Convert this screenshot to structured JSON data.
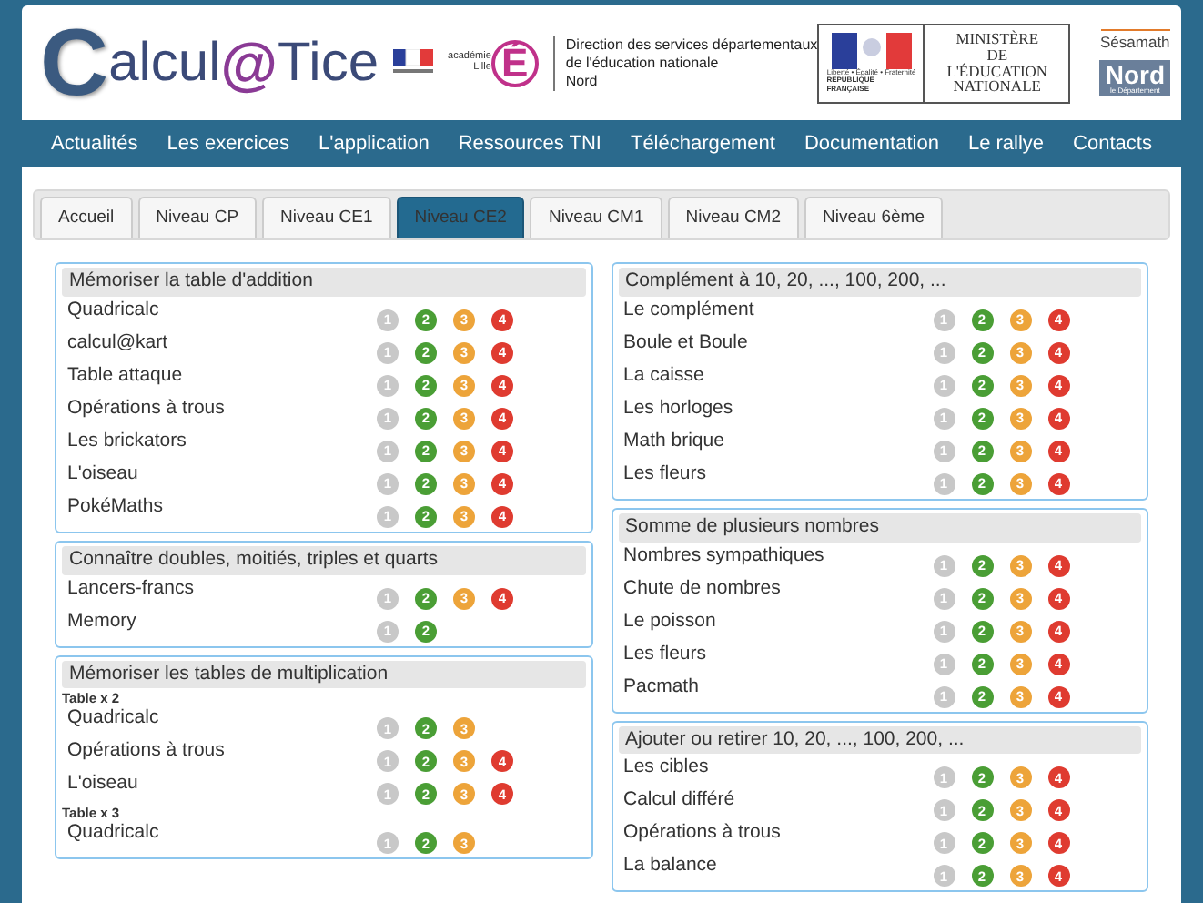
{
  "header": {
    "logo": {
      "initial": "C",
      "part1": "alcul",
      "at": "@",
      "part2": "Tice"
    },
    "academie": {
      "line1": "académie",
      "line2": "Lille",
      "letter": "É"
    },
    "direction": [
      "Direction des services départementaux",
      "de l'éducation nationale",
      "Nord"
    ],
    "ministry": {
      "motto": "Liberté • Égalité • Fraternité",
      "republic": "RÉPUBLIQUE FRANÇAISE",
      "name": [
        "MINISTÈRE",
        "DE L'ÉDUCATION",
        "NATIONALE"
      ]
    },
    "sesamath": "Sésamath",
    "nord": {
      "name": "Nord",
      "sub": "le Département"
    }
  },
  "nav": [
    "Actualités",
    "Les exercices",
    "L'application",
    "Ressources TNI",
    "Téléchargement",
    "Documentation",
    "Le rallye",
    "Contacts"
  ],
  "tabs": [
    {
      "label": "Accueil",
      "selected": false
    },
    {
      "label": "Niveau CP",
      "selected": false
    },
    {
      "label": "Niveau CE1",
      "selected": false
    },
    {
      "label": "Niveau CE2",
      "selected": true
    },
    {
      "label": "Niveau CM1",
      "selected": false
    },
    {
      "label": "Niveau CM2",
      "selected": false
    },
    {
      "label": "Niveau 6ème",
      "selected": false
    }
  ],
  "columns": [
    [
      {
        "title": "Mémoriser la table d'addition",
        "items": [
          {
            "kind": "exercise",
            "name": "Quadricalc",
            "levels": [
              {
                "label": "1",
                "color": "#c8c8c8"
              },
              {
                "label": "2",
                "color": "#4a9e35"
              },
              {
                "label": "3",
                "color": "#eda43a"
              },
              {
                "label": "4",
                "color": "#df3b30"
              }
            ]
          },
          {
            "kind": "exercise",
            "name": "calcul@kart",
            "levels": [
              {
                "label": "1",
                "color": "#c8c8c8"
              },
              {
                "label": "2",
                "color": "#4a9e35"
              },
              {
                "label": "3",
                "color": "#eda43a"
              },
              {
                "label": "4",
                "color": "#df3b30"
              }
            ]
          },
          {
            "kind": "exercise",
            "name": "Table attaque",
            "levels": [
              {
                "label": "1",
                "color": "#c8c8c8"
              },
              {
                "label": "2",
                "color": "#4a9e35"
              },
              {
                "label": "3",
                "color": "#eda43a"
              },
              {
                "label": "4",
                "color": "#df3b30"
              }
            ]
          },
          {
            "kind": "exercise",
            "name": "Opérations à trous",
            "levels": [
              {
                "label": "1",
                "color": "#c8c8c8"
              },
              {
                "label": "2",
                "color": "#4a9e35"
              },
              {
                "label": "3",
                "color": "#eda43a"
              },
              {
                "label": "4",
                "color": "#df3b30"
              }
            ]
          },
          {
            "kind": "exercise",
            "name": "Les brickators",
            "levels": [
              {
                "label": "1",
                "color": "#c8c8c8"
              },
              {
                "label": "2",
                "color": "#4a9e35"
              },
              {
                "label": "3",
                "color": "#eda43a"
              },
              {
                "label": "4",
                "color": "#df3b30"
              }
            ]
          },
          {
            "kind": "exercise",
            "name": "L'oiseau",
            "levels": [
              {
                "label": "1",
                "color": "#c8c8c8"
              },
              {
                "label": "2",
                "color": "#4a9e35"
              },
              {
                "label": "3",
                "color": "#eda43a"
              },
              {
                "label": "4",
                "color": "#df3b30"
              }
            ]
          },
          {
            "kind": "exercise",
            "name": "PokéMaths",
            "levels": [
              {
                "label": "1",
                "color": "#c8c8c8"
              },
              {
                "label": "2",
                "color": "#4a9e35"
              },
              {
                "label": "3",
                "color": "#eda43a"
              },
              {
                "label": "4",
                "color": "#df3b30"
              }
            ]
          }
        ]
      },
      {
        "title": "Connaître doubles, moitiés, triples et quarts",
        "items": [
          {
            "kind": "exercise",
            "name": "Lancers-francs",
            "levels": [
              {
                "label": "1",
                "color": "#c8c8c8"
              },
              {
                "label": "2",
                "color": "#4a9e35"
              },
              {
                "label": "3",
                "color": "#eda43a"
              },
              {
                "label": "4",
                "color": "#df3b30"
              }
            ]
          },
          {
            "kind": "exercise",
            "name": "Memory",
            "levels": [
              {
                "label": "1",
                "color": "#c8c8c8"
              },
              {
                "label": "2",
                "color": "#4a9e35"
              }
            ]
          }
        ]
      },
      {
        "title": "Mémoriser les tables de multiplication",
        "items": [
          {
            "kind": "heading",
            "name": "Table x 2"
          },
          {
            "kind": "exercise",
            "name": "Quadricalc",
            "levels": [
              {
                "label": "1",
                "color": "#c8c8c8"
              },
              {
                "label": "2",
                "color": "#4a9e35"
              },
              {
                "label": "3",
                "color": "#eda43a"
              }
            ]
          },
          {
            "kind": "exercise",
            "name": "Opérations à trous",
            "levels": [
              {
                "label": "1",
                "color": "#c8c8c8"
              },
              {
                "label": "2",
                "color": "#4a9e35"
              },
              {
                "label": "3",
                "color": "#eda43a"
              },
              {
                "label": "4",
                "color": "#df3b30"
              }
            ]
          },
          {
            "kind": "exercise",
            "name": "L'oiseau",
            "levels": [
              {
                "label": "1",
                "color": "#c8c8c8"
              },
              {
                "label": "2",
                "color": "#4a9e35"
              },
              {
                "label": "3",
                "color": "#eda43a"
              },
              {
                "label": "4",
                "color": "#df3b30"
              }
            ]
          },
          {
            "kind": "heading",
            "name": "Table x 3"
          },
          {
            "kind": "exercise",
            "name": "Quadricalc",
            "levels": [
              {
                "label": "1",
                "color": "#c8c8c8"
              },
              {
                "label": "2",
                "color": "#4a9e35"
              },
              {
                "label": "3",
                "color": "#eda43a"
              }
            ]
          }
        ]
      }
    ],
    [
      {
        "title": "Complément à 10, 20, ..., 100, 200, ...",
        "items": [
          {
            "kind": "exercise",
            "name": "Le complément",
            "levels": [
              {
                "label": "1",
                "color": "#c8c8c8"
              },
              {
                "label": "2",
                "color": "#4a9e35"
              },
              {
                "label": "3",
                "color": "#eda43a"
              },
              {
                "label": "4",
                "color": "#df3b30"
              }
            ]
          },
          {
            "kind": "exercise",
            "name": "Boule et Boule",
            "levels": [
              {
                "label": "1",
                "color": "#c8c8c8"
              },
              {
                "label": "2",
                "color": "#4a9e35"
              },
              {
                "label": "3",
                "color": "#eda43a"
              },
              {
                "label": "4",
                "color": "#df3b30"
              }
            ]
          },
          {
            "kind": "exercise",
            "name": "La caisse",
            "levels": [
              {
                "label": "1",
                "color": "#c8c8c8"
              },
              {
                "label": "2",
                "color": "#4a9e35"
              },
              {
                "label": "3",
                "color": "#eda43a"
              },
              {
                "label": "4",
                "color": "#df3b30"
              }
            ]
          },
          {
            "kind": "exercise",
            "name": "Les horloges",
            "levels": [
              {
                "label": "1",
                "color": "#c8c8c8"
              },
              {
                "label": "2",
                "color": "#4a9e35"
              },
              {
                "label": "3",
                "color": "#eda43a"
              },
              {
                "label": "4",
                "color": "#df3b30"
              }
            ]
          },
          {
            "kind": "exercise",
            "name": "Math brique",
            "levels": [
              {
                "label": "1",
                "color": "#c8c8c8"
              },
              {
                "label": "2",
                "color": "#4a9e35"
              },
              {
                "label": "3",
                "color": "#eda43a"
              },
              {
                "label": "4",
                "color": "#df3b30"
              }
            ]
          },
          {
            "kind": "exercise",
            "name": "Les fleurs",
            "levels": [
              {
                "label": "1",
                "color": "#c8c8c8"
              },
              {
                "label": "2",
                "color": "#4a9e35"
              },
              {
                "label": "3",
                "color": "#eda43a"
              },
              {
                "label": "4",
                "color": "#df3b30"
              }
            ]
          }
        ]
      },
      {
        "title": "Somme de plusieurs nombres",
        "items": [
          {
            "kind": "exercise",
            "name": "Nombres sympathiques",
            "levels": [
              {
                "label": "1",
                "color": "#c8c8c8"
              },
              {
                "label": "2",
                "color": "#4a9e35"
              },
              {
                "label": "3",
                "color": "#eda43a"
              },
              {
                "label": "4",
                "color": "#df3b30"
              }
            ]
          },
          {
            "kind": "exercise",
            "name": "Chute de nombres",
            "levels": [
              {
                "label": "1",
                "color": "#c8c8c8"
              },
              {
                "label": "2",
                "color": "#4a9e35"
              },
              {
                "label": "3",
                "color": "#eda43a"
              },
              {
                "label": "4",
                "color": "#df3b30"
              }
            ]
          },
          {
            "kind": "exercise",
            "name": "Le poisson",
            "levels": [
              {
                "label": "1",
                "color": "#c8c8c8"
              },
              {
                "label": "2",
                "color": "#4a9e35"
              },
              {
                "label": "3",
                "color": "#eda43a"
              },
              {
                "label": "4",
                "color": "#df3b30"
              }
            ]
          },
          {
            "kind": "exercise",
            "name": "Les fleurs",
            "levels": [
              {
                "label": "1",
                "color": "#c8c8c8"
              },
              {
                "label": "2",
                "color": "#4a9e35"
              },
              {
                "label": "3",
                "color": "#eda43a"
              },
              {
                "label": "4",
                "color": "#df3b30"
              }
            ]
          },
          {
            "kind": "exercise",
            "name": "Pacmath",
            "levels": [
              {
                "label": "1",
                "color": "#c8c8c8"
              },
              {
                "label": "2",
                "color": "#4a9e35"
              },
              {
                "label": "3",
                "color": "#eda43a"
              },
              {
                "label": "4",
                "color": "#df3b30"
              }
            ]
          }
        ]
      },
      {
        "title": "Ajouter ou retirer 10, 20, ..., 100, 200, ...",
        "items": [
          {
            "kind": "exercise",
            "name": "Les cibles",
            "levels": [
              {
                "label": "1",
                "color": "#c8c8c8"
              },
              {
                "label": "2",
                "color": "#4a9e35"
              },
              {
                "label": "3",
                "color": "#eda43a"
              },
              {
                "label": "4",
                "color": "#df3b30"
              }
            ]
          },
          {
            "kind": "exercise",
            "name": "Calcul différé",
            "levels": [
              {
                "label": "1",
                "color": "#c8c8c8"
              },
              {
                "label": "2",
                "color": "#4a9e35"
              },
              {
                "label": "3",
                "color": "#eda43a"
              },
              {
                "label": "4",
                "color": "#df3b30"
              }
            ]
          },
          {
            "kind": "exercise",
            "name": "Opérations à trous",
            "levels": [
              {
                "label": "1",
                "color": "#c8c8c8"
              },
              {
                "label": "2",
                "color": "#4a9e35"
              },
              {
                "label": "3",
                "color": "#eda43a"
              },
              {
                "label": "4",
                "color": "#df3b30"
              }
            ]
          },
          {
            "kind": "exercise",
            "name": "La balance",
            "levels": [
              {
                "label": "1",
                "color": "#c8c8c8"
              },
              {
                "label": "2",
                "color": "#4a9e35"
              },
              {
                "label": "3",
                "color": "#eda43a"
              },
              {
                "label": "4",
                "color": "#df3b30"
              }
            ]
          }
        ]
      }
    ]
  ]
}
